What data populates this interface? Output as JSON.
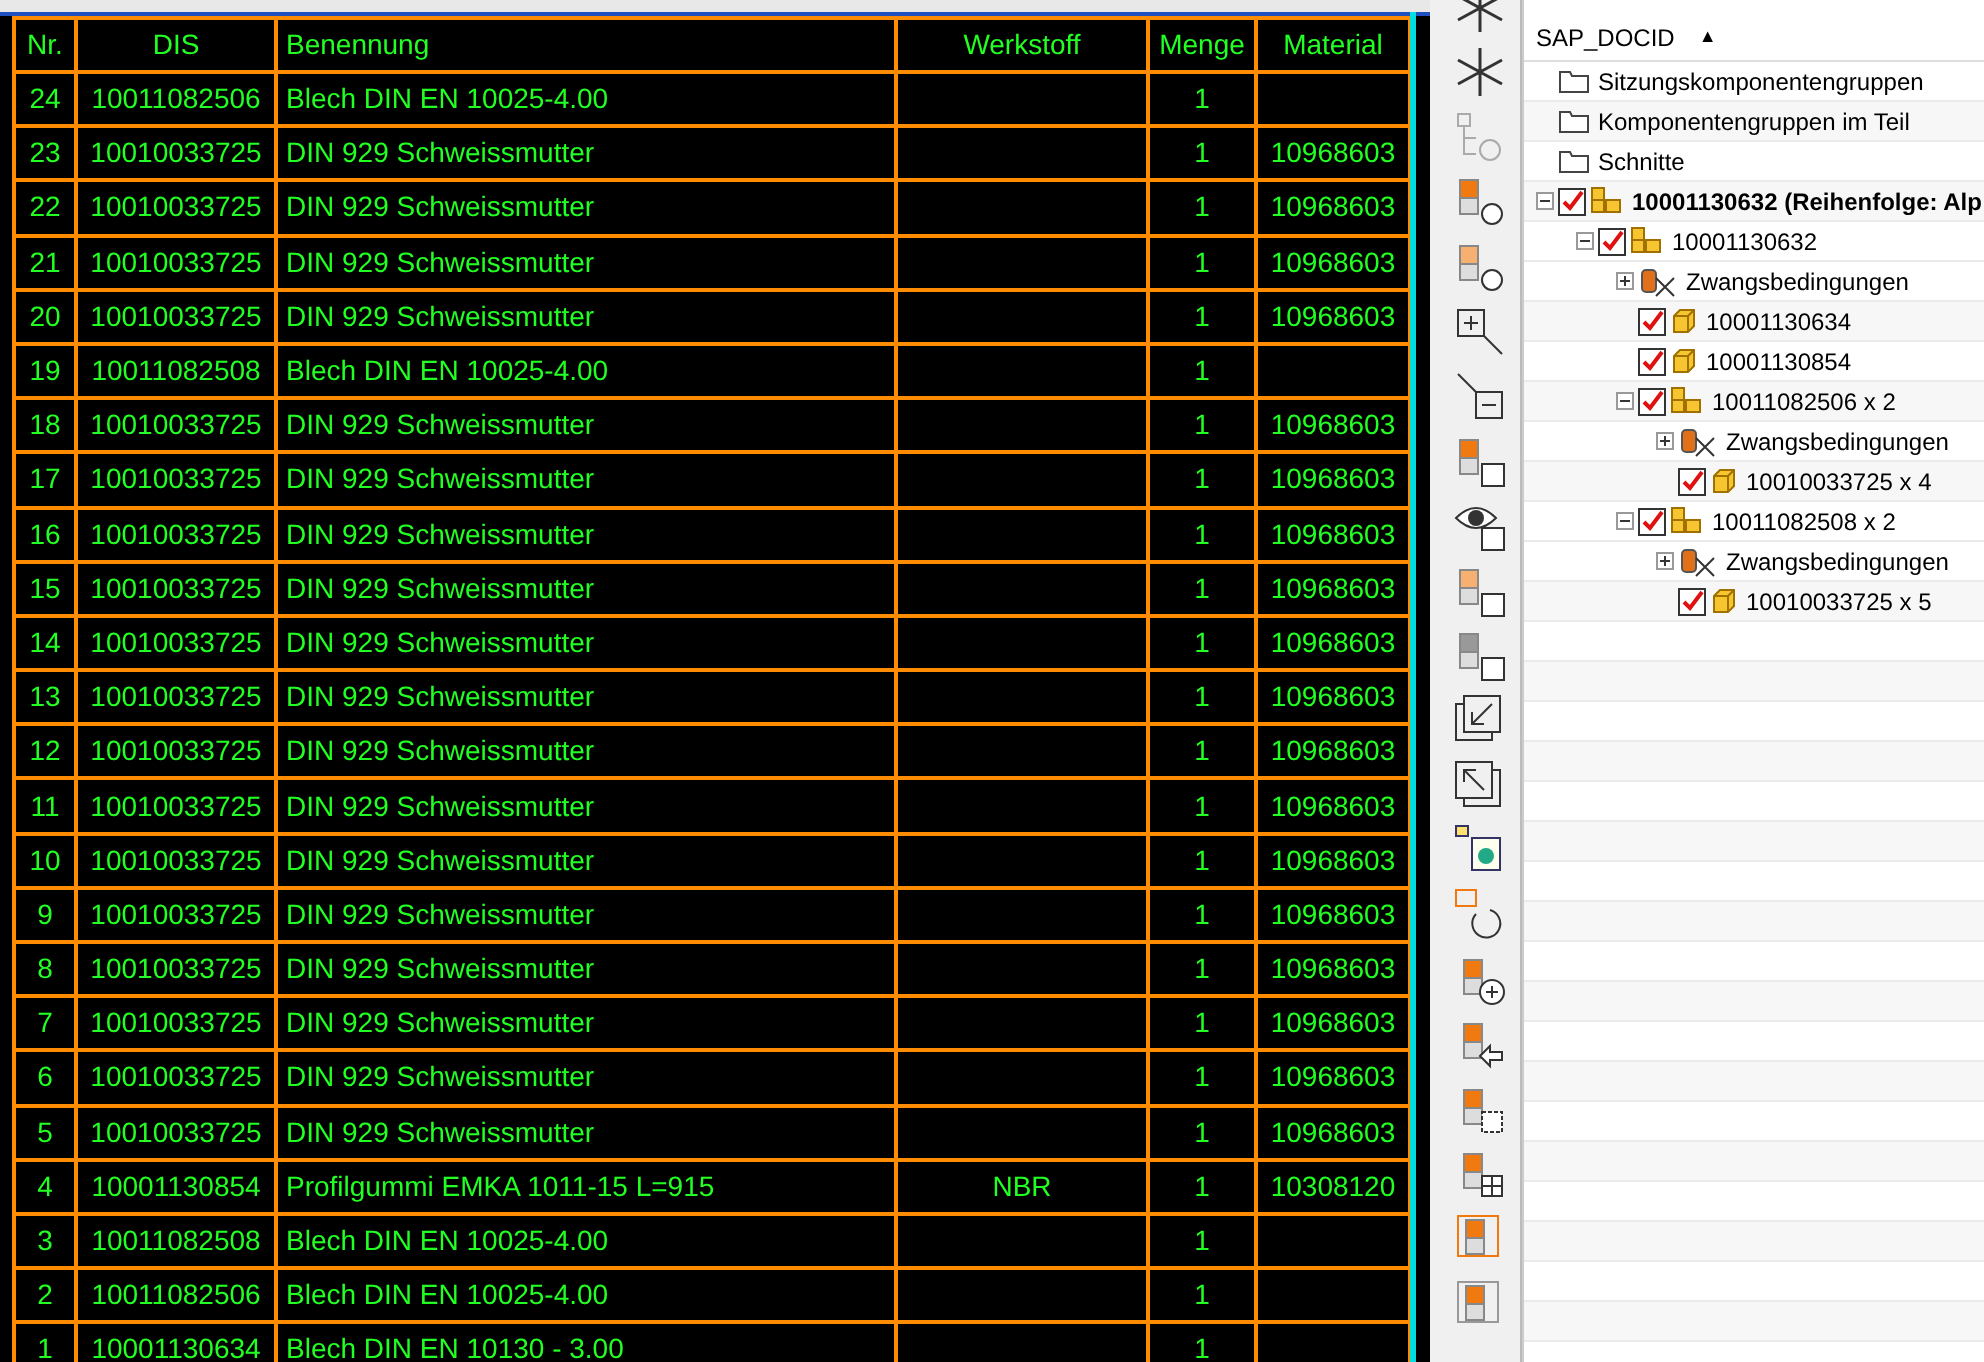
{
  "table": {
    "columns": [
      "Nr.",
      "DIS",
      "Benennung",
      "Werkstoff",
      "Menge",
      "Material"
    ],
    "rows": [
      {
        "nr": "24",
        "dis": "10011082506",
        "name": "Blech DIN EN 10025-4.00",
        "material_type": "",
        "qty": "1",
        "material": ""
      },
      {
        "nr": "23",
        "dis": "10010033725",
        "name": "DIN 929 Schweissmutter",
        "material_type": "",
        "qty": "1",
        "material": "10968603"
      },
      {
        "nr": "22",
        "dis": "10010033725",
        "name": "DIN 929 Schweissmutter",
        "material_type": "",
        "qty": "1",
        "material": "10968603"
      },
      {
        "nr": "21",
        "dis": "10010033725",
        "name": "DIN 929 Schweissmutter",
        "material_type": "",
        "qty": "1",
        "material": "10968603"
      },
      {
        "nr": "20",
        "dis": "10010033725",
        "name": "DIN 929 Schweissmutter",
        "material_type": "",
        "qty": "1",
        "material": "10968603"
      },
      {
        "nr": "19",
        "dis": "10011082508",
        "name": "Blech DIN EN 10025-4.00",
        "material_type": "",
        "qty": "1",
        "material": ""
      },
      {
        "nr": "18",
        "dis": "10010033725",
        "name": "DIN 929 Schweissmutter",
        "material_type": "",
        "qty": "1",
        "material": "10968603"
      },
      {
        "nr": "17",
        "dis": "10010033725",
        "name": "DIN 929 Schweissmutter",
        "material_type": "",
        "qty": "1",
        "material": "10968603"
      },
      {
        "nr": "16",
        "dis": "10010033725",
        "name": "DIN 929 Schweissmutter",
        "material_type": "",
        "qty": "1",
        "material": "10968603"
      },
      {
        "nr": "15",
        "dis": "10010033725",
        "name": "DIN 929 Schweissmutter",
        "material_type": "",
        "qty": "1",
        "material": "10968603"
      },
      {
        "nr": "14",
        "dis": "10010033725",
        "name": "DIN 929 Schweissmutter",
        "material_type": "",
        "qty": "1",
        "material": "10968603"
      },
      {
        "nr": "13",
        "dis": "10010033725",
        "name": "DIN 929 Schweissmutter",
        "material_type": "",
        "qty": "1",
        "material": "10968603"
      },
      {
        "nr": "12",
        "dis": "10010033725",
        "name": "DIN 929 Schweissmutter",
        "material_type": "",
        "qty": "1",
        "material": "10968603"
      },
      {
        "nr": "11",
        "dis": "10010033725",
        "name": "DIN 929 Schweissmutter",
        "material_type": "",
        "qty": "1",
        "material": "10968603"
      },
      {
        "nr": "10",
        "dis": "10010033725",
        "name": "DIN 929 Schweissmutter",
        "material_type": "",
        "qty": "1",
        "material": "10968603"
      },
      {
        "nr": "9",
        "dis": "10010033725",
        "name": "DIN 929 Schweissmutter",
        "material_type": "",
        "qty": "1",
        "material": "10968603"
      },
      {
        "nr": "8",
        "dis": "10010033725",
        "name": "DIN 929 Schweissmutter",
        "material_type": "",
        "qty": "1",
        "material": "10968603"
      },
      {
        "nr": "7",
        "dis": "10010033725",
        "name": "DIN 929 Schweissmutter",
        "material_type": "",
        "qty": "1",
        "material": "10968603"
      },
      {
        "nr": "6",
        "dis": "10010033725",
        "name": "DIN 929 Schweissmutter",
        "material_type": "",
        "qty": "1",
        "material": "10968603"
      },
      {
        "nr": "5",
        "dis": "10010033725",
        "name": "DIN 929 Schweissmutter",
        "material_type": "",
        "qty": "1",
        "material": "10968603"
      },
      {
        "nr": "4",
        "dis": "10001130854",
        "name": "Profilgummi EMKA 1011-15 L=915",
        "material_type": "NBR",
        "qty": "1",
        "material": "10308120"
      },
      {
        "nr": "3",
        "dis": "10011082508",
        "name": "Blech DIN EN 10025-4.00",
        "material_type": "",
        "qty": "1",
        "material": ""
      },
      {
        "nr": "2",
        "dis": "10011082506",
        "name": "Blech DIN EN 10025-4.00",
        "material_type": "",
        "qty": "1",
        "material": ""
      },
      {
        "nr": "1",
        "dis": "10001130634",
        "name": "Blech DIN EN 10130 - 3.00",
        "material_type": "",
        "qty": "1",
        "material": ""
      }
    ]
  },
  "tree": {
    "column": "SAP_DOCID",
    "sort_indicator": "▲",
    "items": [
      {
        "kind": "folder",
        "label": "Sitzungskomponentengruppen"
      },
      {
        "kind": "folder",
        "label": "Komponentengruppen im Teil"
      },
      {
        "kind": "folder",
        "label": "Schnitte"
      },
      {
        "kind": "assembly",
        "label": "10001130632 (Reihenfolge: Alp",
        "bold": true,
        "checked": true,
        "expanded": true,
        "children": [
          {
            "kind": "assembly",
            "label": "10001130632",
            "checked": true,
            "expanded": true,
            "children": [
              {
                "kind": "constraint",
                "label": "Zwangsbedingungen",
                "expanded": false
              },
              {
                "kind": "part",
                "label": "10001130634",
                "checked": true
              },
              {
                "kind": "part",
                "label": "10001130854",
                "checked": true
              },
              {
                "kind": "assembly",
                "label": "10011082506 x 2",
                "checked": true,
                "expanded": true,
                "children": [
                  {
                    "kind": "constraint",
                    "label": "Zwangsbedingungen",
                    "expanded": false
                  },
                  {
                    "kind": "part",
                    "label": "10010033725 x 4",
                    "checked": true
                  }
                ]
              },
              {
                "kind": "assembly",
                "label": "10011082508 x 2",
                "checked": true,
                "expanded": true,
                "children": [
                  {
                    "kind": "constraint",
                    "label": "Zwangsbedingungen",
                    "expanded": false
                  },
                  {
                    "kind": "part",
                    "label": "10010033725 x 5",
                    "checked": true
                  }
                ]
              }
            ]
          }
        ]
      }
    ]
  }
}
